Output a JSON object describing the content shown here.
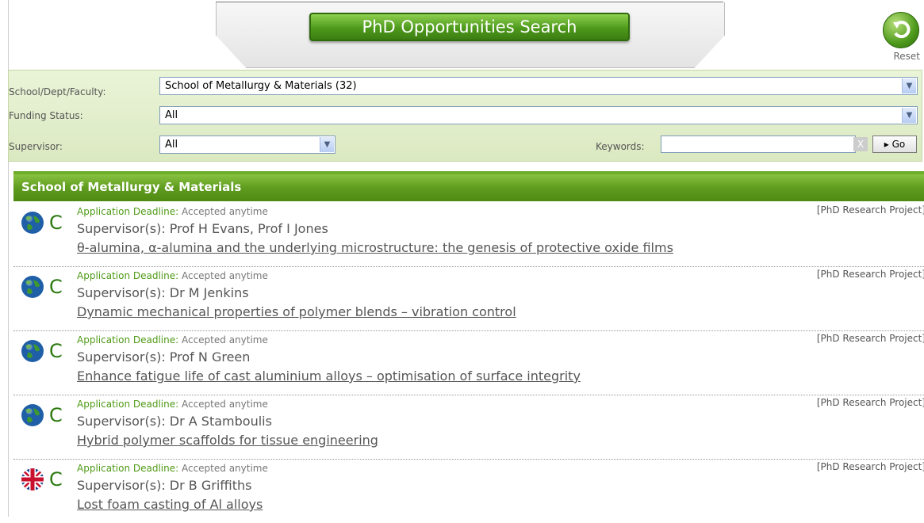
{
  "header": {
    "title": "PhD Opportunities Search",
    "reset_label": "Reset"
  },
  "filters": {
    "school_label": "School/Dept/Faculty:",
    "school_value": "School of Metallurgy & Materials (32)",
    "funding_label": "Funding Status:",
    "funding_value": "All",
    "supervisor_label": "Supervisor:",
    "supervisor_value": "All",
    "keywords_label": "Keywords:",
    "keywords_value": "",
    "clear_label": "X",
    "go_label": "▸ Go"
  },
  "section": {
    "title": "School of Metallurgy & Materials"
  },
  "results": [
    {
      "icon": "globe-icon",
      "mode_letter": "C",
      "deadline_label": "Application Deadline:",
      "deadline_value": "Accepted anytime",
      "supervisor": "Supervisor(s): Prof H Evans, Prof I Jones",
      "title": "θ-alumina, α-alumina and the underlying microstructure: the genesis of protective oxide films",
      "type": "[PhD Research Project]"
    },
    {
      "icon": "globe-icon",
      "mode_letter": "C",
      "deadline_label": "Application Deadline:",
      "deadline_value": "Accepted anytime",
      "supervisor": "Supervisor(s): Dr M Jenkins",
      "title": "Dynamic mechanical properties of polymer blends – vibration control",
      "type": "[PhD Research Project]"
    },
    {
      "icon": "globe-icon",
      "mode_letter": "C",
      "deadline_label": "Application Deadline:",
      "deadline_value": "Accepted anytime",
      "supervisor": "Supervisor(s): Prof N Green",
      "title": "Enhance fatigue life of cast aluminium alloys – optimisation of surface integrity",
      "type": "[PhD Research Project]"
    },
    {
      "icon": "globe-icon",
      "mode_letter": "C",
      "deadline_label": "Application Deadline:",
      "deadline_value": "Accepted anytime",
      "supervisor": "Supervisor(s): Dr A Stamboulis",
      "title": "Hybrid polymer scaffolds for tissue engineering",
      "type": "[PhD Research Project]"
    },
    {
      "icon": "uk-flag-icon",
      "mode_letter": "C",
      "deadline_label": "Application Deadline:",
      "deadline_value": "Accepted anytime",
      "supervisor": "Supervisor(s): Dr B Griffiths",
      "title": "Lost foam casting of Al alloys",
      "type": "[PhD Research Project]"
    }
  ]
}
